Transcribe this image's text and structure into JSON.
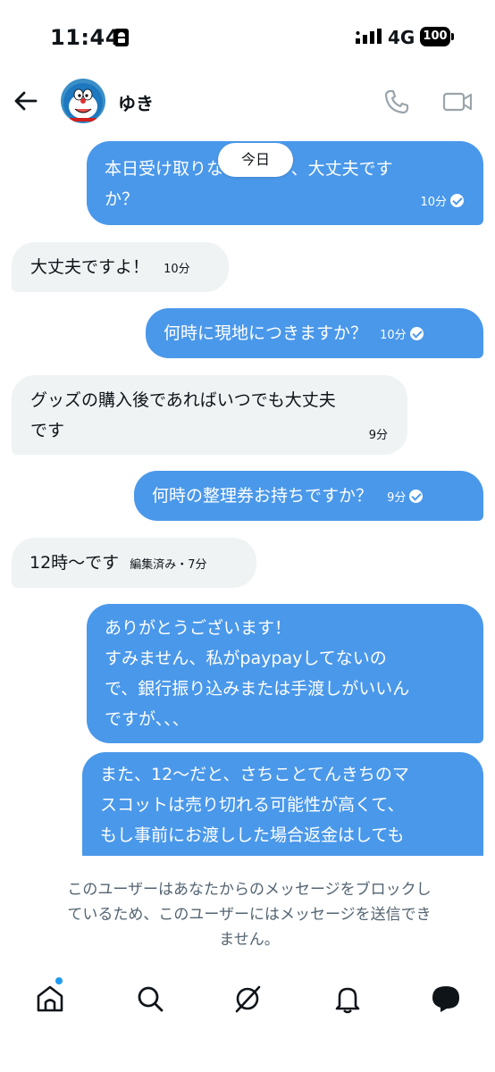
{
  "status_bar": {
    "time": "11:44",
    "network": "4G",
    "battery": "100"
  },
  "header": {
    "username": "ゆき"
  },
  "date_pill": "今日",
  "messages": [
    {
      "side": "sent",
      "line1": "本日受け取りなのですが、大丈夫です",
      "line2": "か？",
      "time": "10分"
    },
    {
      "side": "recv",
      "text": "大丈夫ですよ！",
      "time": "10分"
    },
    {
      "side": "sent",
      "text": "何時に現地につきますか？",
      "time": "10分"
    },
    {
      "side": "recv",
      "line1": "グッズの購入後であればいつでも大丈夫",
      "line2": "です",
      "time": "9分"
    },
    {
      "side": "sent",
      "text": "何時の整理券お持ちですか？",
      "time": "9分"
    },
    {
      "side": "recv",
      "text": "12時〜です",
      "time": "編集済み・7分"
    },
    {
      "side": "sent",
      "lines": [
        "ありがとうございます！",
        "すみません、私がpaypayしてないの",
        "で、銀行振り込みまたは手渡しがいいん",
        "ですが、、、"
      ]
    },
    {
      "side": "sent",
      "lines": [
        "また、12〜だと、さちことてんきちのマ",
        "スコットは売り切れる可能性が高くて、",
        "もし事前にお渡しした場合返金はしても"
      ]
    }
  ],
  "blocked_notice": {
    "line1": "このユーザーはあなたからのメッセージをブロックし",
    "line2": "ているため、このユーザーにはメッセージを送信でき",
    "line3": "ません。"
  },
  "bottom_nav": [
    "home-icon",
    "search-icon",
    "grok-icon",
    "notifications-icon",
    "messages-icon"
  ],
  "colors": {
    "sent_bubble": "#4a98ea",
    "received_bubble": "#eff3f4",
    "accent": "#1d9bf0"
  }
}
